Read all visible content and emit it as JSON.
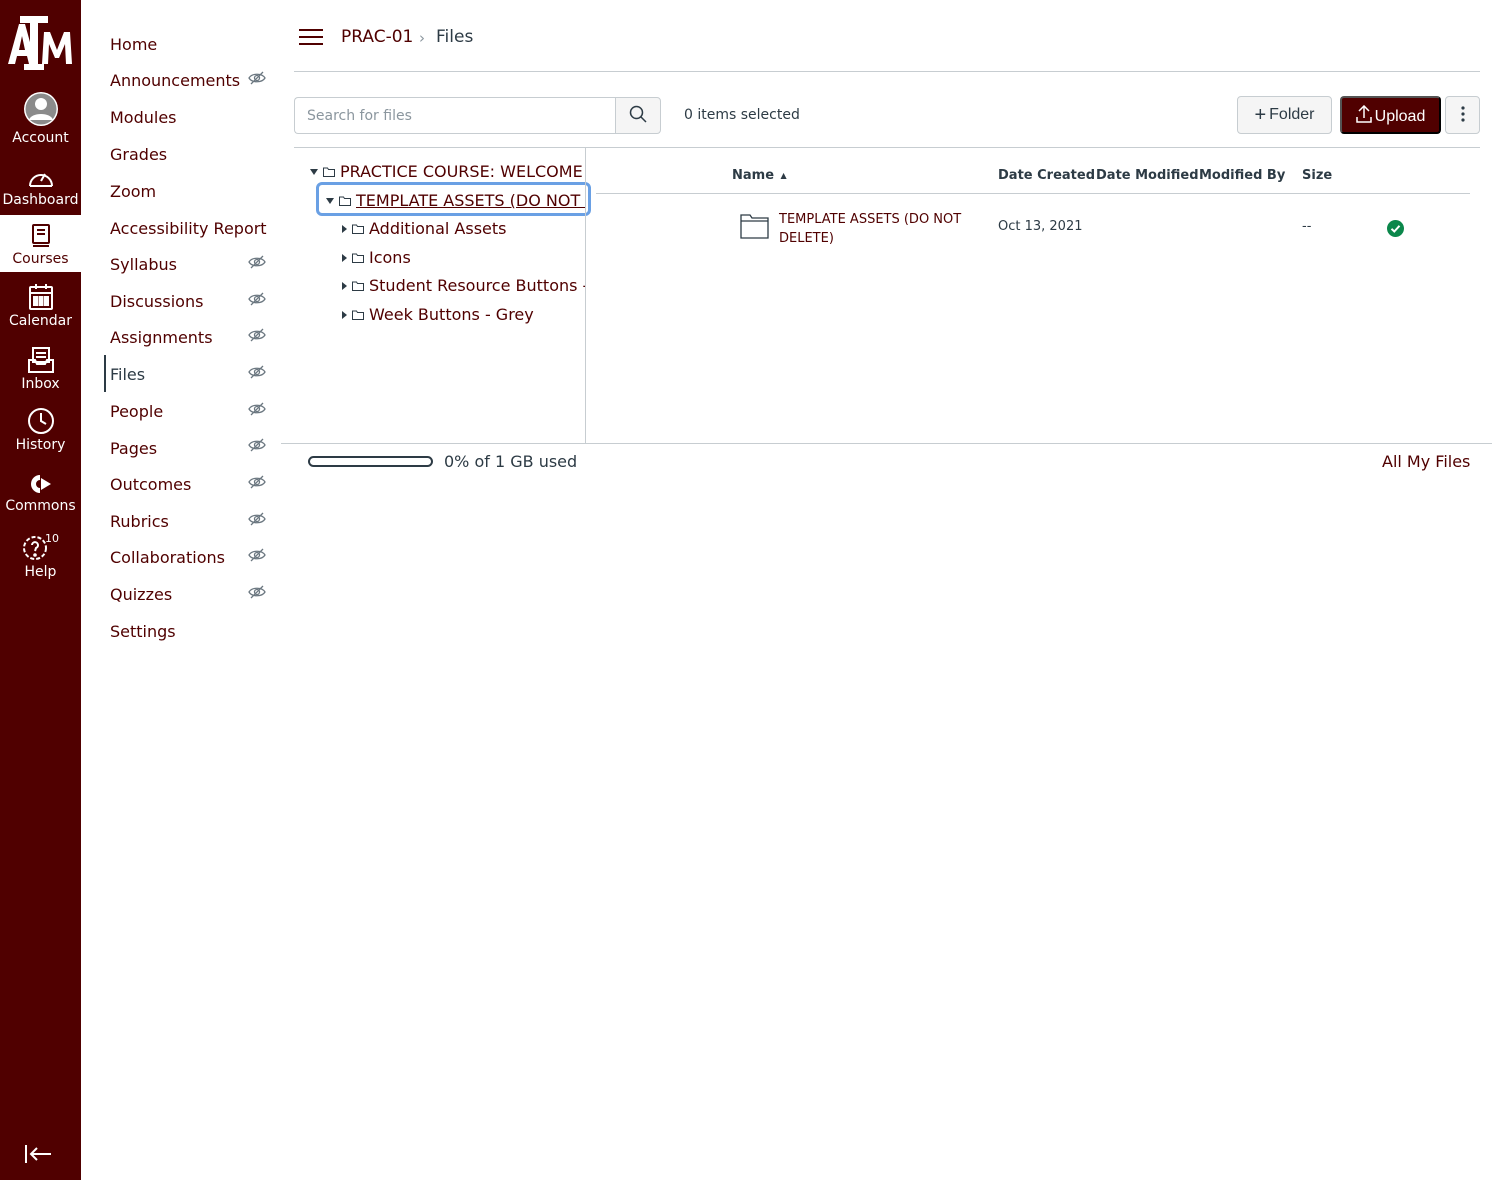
{
  "global_nav": {
    "logo_text": "ATM",
    "items": [
      {
        "label": "Account",
        "icon": "account-icon"
      },
      {
        "label": "Dashboard",
        "icon": "dashboard-icon"
      },
      {
        "label": "Courses",
        "icon": "courses-icon"
      },
      {
        "label": "Calendar",
        "icon": "calendar-icon"
      },
      {
        "label": "Inbox",
        "icon": "inbox-icon"
      },
      {
        "label": "History",
        "icon": "history-icon"
      },
      {
        "label": "Commons",
        "icon": "commons-icon"
      },
      {
        "label": "Help",
        "icon": "help-icon",
        "badge": "10"
      }
    ],
    "active": "Courses"
  },
  "course_nav": {
    "items": [
      {
        "label": "Home",
        "hidden_icon": false
      },
      {
        "label": "Announcements",
        "hidden_icon": true
      },
      {
        "label": "Modules",
        "hidden_icon": false
      },
      {
        "label": "Grades",
        "hidden_icon": false
      },
      {
        "label": "Zoom",
        "hidden_icon": false
      },
      {
        "label": "Accessibility Report",
        "hidden_icon": false
      },
      {
        "label": "Syllabus",
        "hidden_icon": true
      },
      {
        "label": "Discussions",
        "hidden_icon": true
      },
      {
        "label": "Assignments",
        "hidden_icon": true
      },
      {
        "label": "Files",
        "hidden_icon": true
      },
      {
        "label": "People",
        "hidden_icon": true
      },
      {
        "label": "Pages",
        "hidden_icon": true
      },
      {
        "label": "Outcomes",
        "hidden_icon": true
      },
      {
        "label": "Rubrics",
        "hidden_icon": true
      },
      {
        "label": "Collaborations",
        "hidden_icon": true
      },
      {
        "label": "Quizzes",
        "hidden_icon": true
      },
      {
        "label": "Settings",
        "hidden_icon": false
      }
    ],
    "active": "Files"
  },
  "breadcrumb": {
    "course": "PRAC-01",
    "separator": "›",
    "page": "Files"
  },
  "toolbar": {
    "search_placeholder": "Search for files",
    "items_selected": "0 items selected",
    "folder_label": "Folder",
    "upload_label": "Upload"
  },
  "tree": {
    "root": "PRACTICE COURSE: WELCOME T",
    "selected": "TEMPLATE ASSETS (DO NOT D",
    "children": [
      "Additional Assets",
      "Icons",
      "Student Resource Buttons - De",
      "Week Buttons - Grey"
    ]
  },
  "file_list": {
    "columns": {
      "name": "Name",
      "date_created": "Date Created",
      "date_modified": "Date Modified",
      "modified_by": "Modified By",
      "size": "Size"
    },
    "sort_indicator": "▲",
    "rows": [
      {
        "name": "TEMPLATE ASSETS (DO NOT DELETE)",
        "date_created": "Oct 13, 2021",
        "date_modified": "",
        "modified_by": "",
        "size": "--",
        "published": true
      }
    ]
  },
  "footer": {
    "quota_text": "0% of 1 GB used",
    "quota_percent": 0,
    "all_my_files": "All My Files"
  },
  "colors": {
    "brand": "#500000",
    "text": "#2d3b45",
    "border": "#c7cdd1",
    "focus": "#6aa0e4",
    "success": "#0b874b"
  }
}
